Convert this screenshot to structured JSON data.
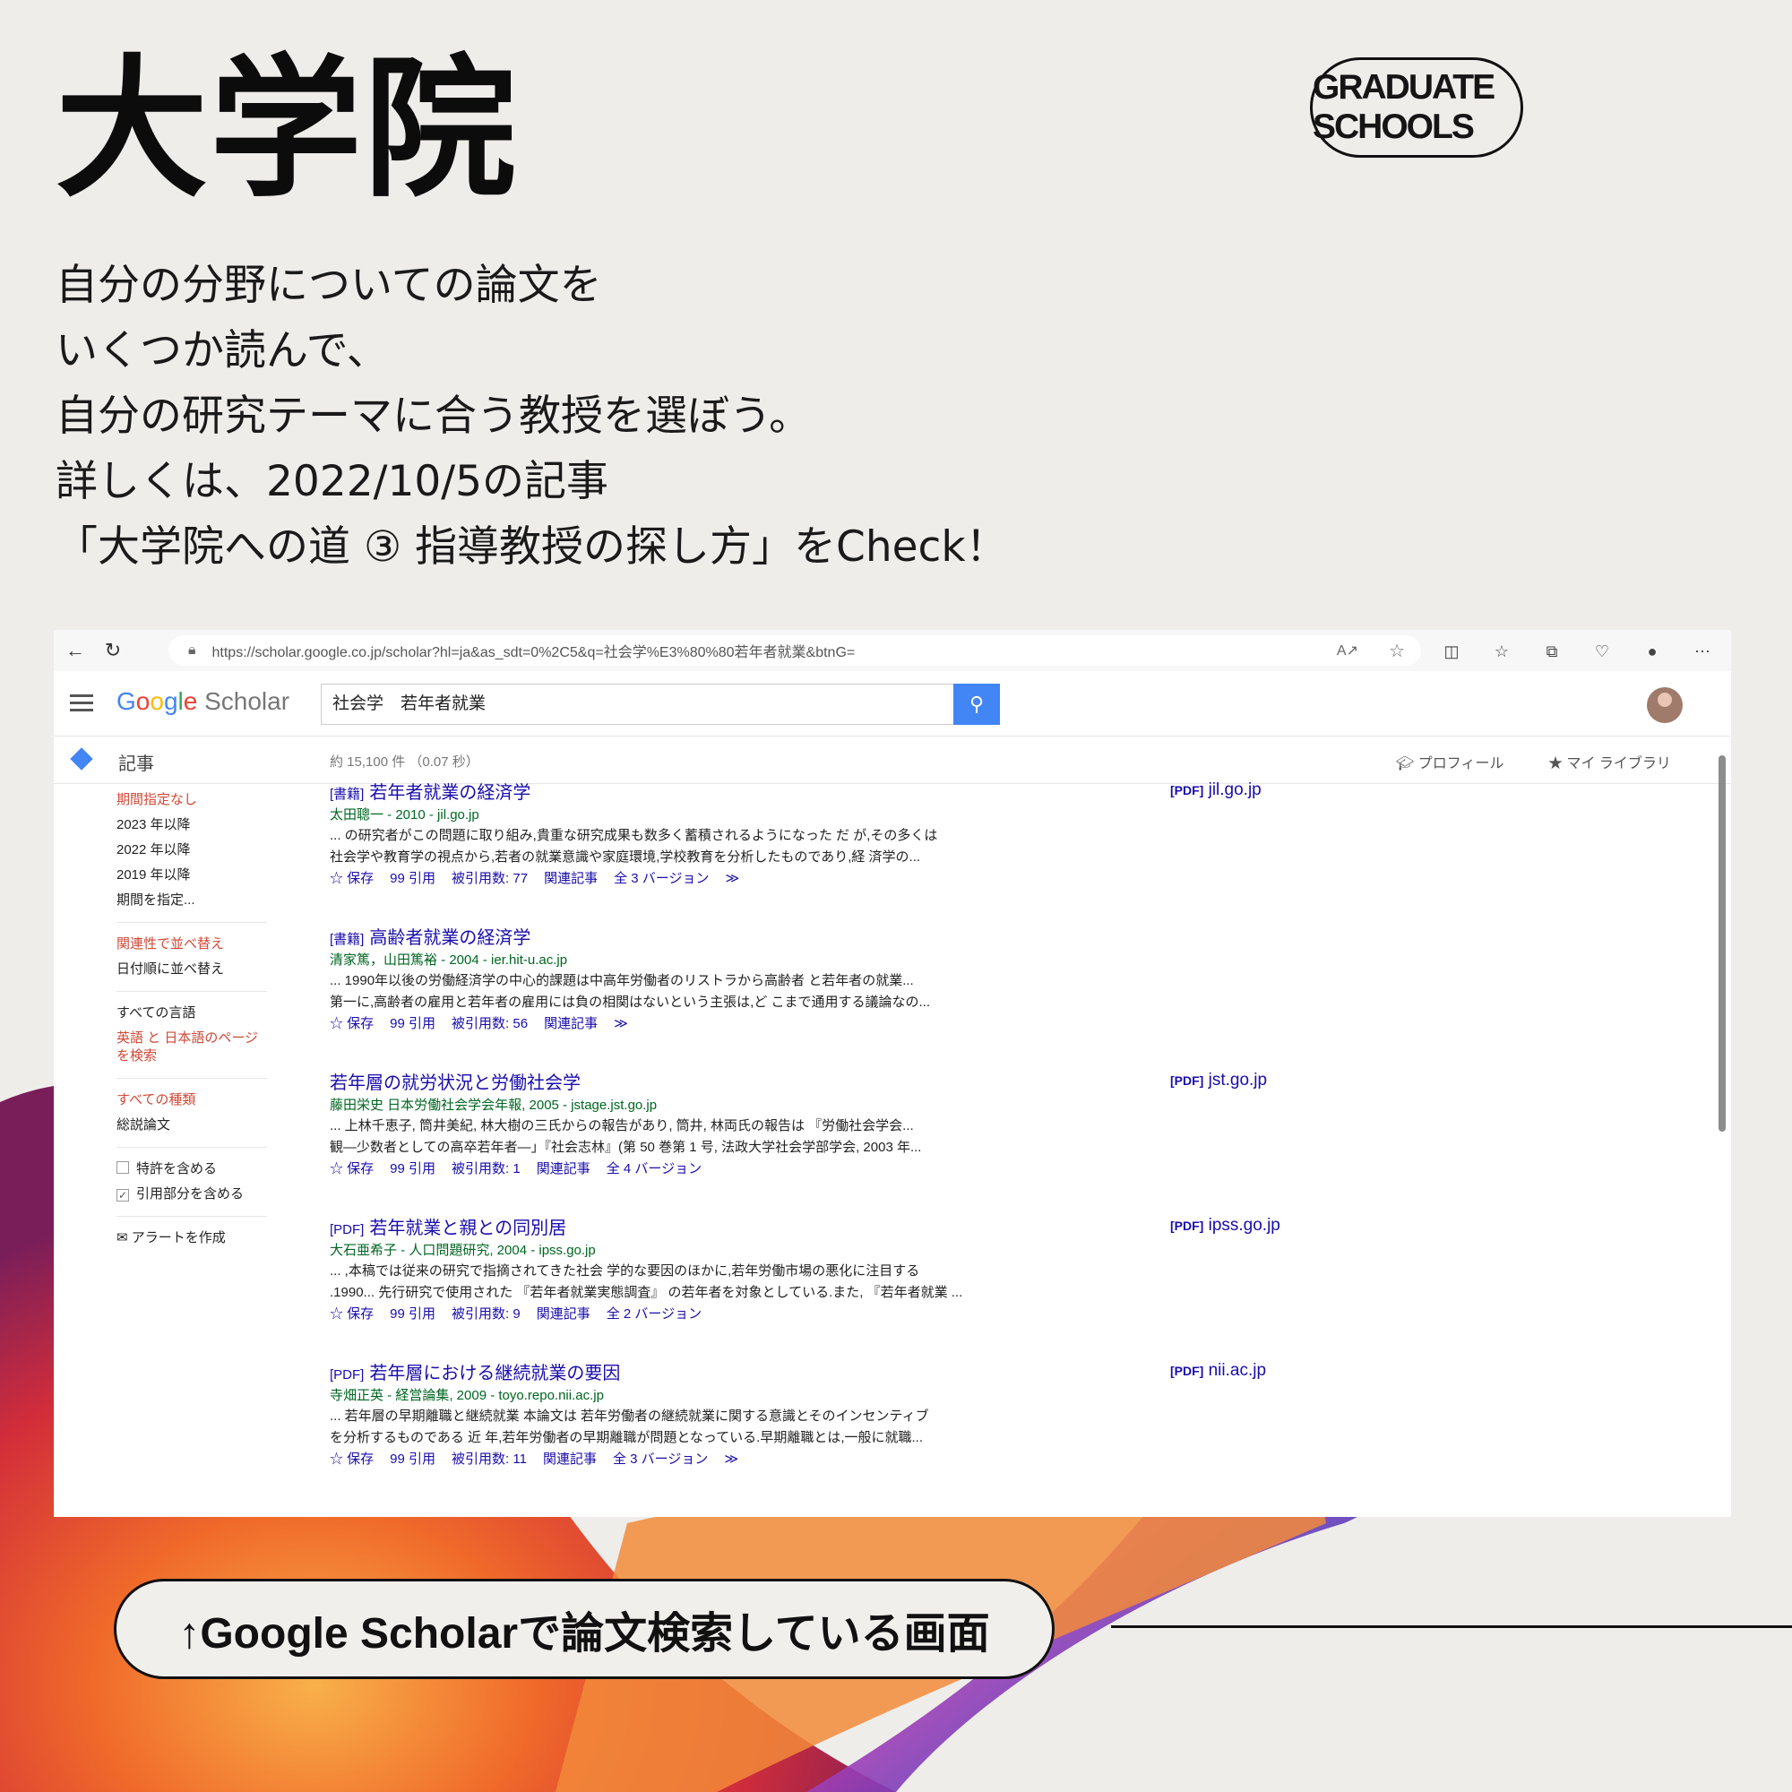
{
  "header": {
    "title": "大学院",
    "tag": "GRADUATE SCHOOLS"
  },
  "intro": {
    "lines": [
      "自分の分野についての論文を",
      "いくつか読んで、",
      "自分の研究テーマに合う教授を選ぼう。",
      "詳しくは、2022/10/5の記事",
      "「大学院への道 ③ 指導教授の探し方」をCheck！"
    ]
  },
  "browser": {
    "url": "https://scholar.google.co.jp/scholar?hl=ja&as_sdt=0%2C5&q=社会学%E3%80%80若年者就業&btnG=",
    "logo_google": "Google",
    "logo_scholar": "Scholar",
    "search_value": "社会学　若年者就業",
    "articles_label": "記事",
    "result_count": "約 15,100 件 （0.07 秒）",
    "profile_label": "プロフィール",
    "library_label": "マイ ライブラリ",
    "sidebar": {
      "time": [
        "期間指定なし",
        "2023 年以降",
        "2022 年以降",
        "2019 年以降",
        "期間を指定..."
      ],
      "sort": [
        "関連性で並べ替え",
        "日付順に並べ替え"
      ],
      "lang": [
        "すべての言語",
        "英語 と 日本語のページを検索"
      ],
      "type": [
        "すべての種類",
        "総説論文"
      ],
      "patent": "特許を含める",
      "citations": "引用部分を含める",
      "alert": "アラートを作成"
    },
    "results": [
      {
        "tag": "[書籍]",
        "title": "若年者就業の経済学",
        "meta": "太田聰一 - 2010 - jil.go.jp",
        "snippet1": "... の研究者がこの問題に取り組み,貴重な研究成果も数多く蓄積されるようになった だ が,その多くは",
        "snippet2": "社会学や教育学の視点から,若者の就業意識や家庭環境,学校教育を分析したものであり,経 済学の...",
        "links": [
          "☆ 保存",
          "99 引用",
          "被引用数: 77",
          "関連記事",
          "全 3 バージョン",
          "≫"
        ],
        "pdf": "jil.go.jp"
      },
      {
        "tag": "[書籍]",
        "title": "高齢者就業の経済学",
        "meta": "清家篤，山田篤裕 - 2004 - ier.hit-u.ac.jp",
        "snippet1": "... 1990年以後の労働経済学の中心的課題は中高年労働者のリストラから高齢者 と若年者の就業...",
        "snippet2": "第一に,高齢者の雇用と若年者の雇用には負の相関はないという主張は,ど こまで通用する議論なの...",
        "links": [
          "☆ 保存",
          "99 引用",
          "被引用数: 56",
          "関連記事",
          "≫"
        ],
        "pdf": ""
      },
      {
        "tag": "",
        "title": "若年層の就労状況と労働社会学",
        "meta": "藤田栄史 日本労働社会学会年報, 2005 - jstage.jst.go.jp",
        "snippet1": "... 上林千恵子, 筒井美紀, 林大樹の三氏からの報告があり, 筒井, 林両氏の報告は 『労働社会学会...",
        "snippet2": "観—少数者としての高卒若年者—」『社会志林』(第 50 巻第 1 号, 法政大学社会学部学会, 2003 年...",
        "links": [
          "☆ 保存",
          "99 引用",
          "被引用数: 1",
          "関連記事",
          "全 4 バージョン"
        ],
        "pdf": "jst.go.jp"
      },
      {
        "tag": "[PDF]",
        "title": "若年就業と親との同別居",
        "meta": "大石亜希子 - 人口問題研究, 2004 - ipss.go.jp",
        "snippet1": "... ,本稿では従来の研究で指摘されてきた社会 学的な要因のほかに,若年労働市場の悪化に注目する",
        "snippet2": ".1990... 先行研究で使用された 『若年者就業実態調査』 の若年者を対象としている.また, 『若年者就業 ...",
        "links": [
          "☆ 保存",
          "99 引用",
          "被引用数: 9",
          "関連記事",
          "全 2 バージョン"
        ],
        "pdf": "ipss.go.jp"
      },
      {
        "tag": "[PDF]",
        "title": "若年層における継続就業の要因",
        "meta": "寺畑正英 - 経営論集, 2009 - toyo.repo.nii.ac.jp",
        "snippet1": "... 若年層の早期離職と継続就業 本論文は 若年労働者の継続就業に関する意識とそのインセンティブ",
        "snippet2": "を分析するものである 近 年,若年労働者の早期離職が問題となっている.早期離職とは,一般に就職...",
        "links": [
          "☆ 保存",
          "99 引用",
          "被引用数: 11",
          "関連記事",
          "全 3 バージョン",
          "≫"
        ],
        "pdf": "nii.ac.jp"
      }
    ],
    "pdf_tag": "[PDF]"
  },
  "caption": "↑Google Scholarで論文検索している画面",
  "colors": {
    "accent_blue": "#4285f4",
    "link": "#1a0dab",
    "green": "#006621",
    "sidebar_red": "#d14836"
  }
}
